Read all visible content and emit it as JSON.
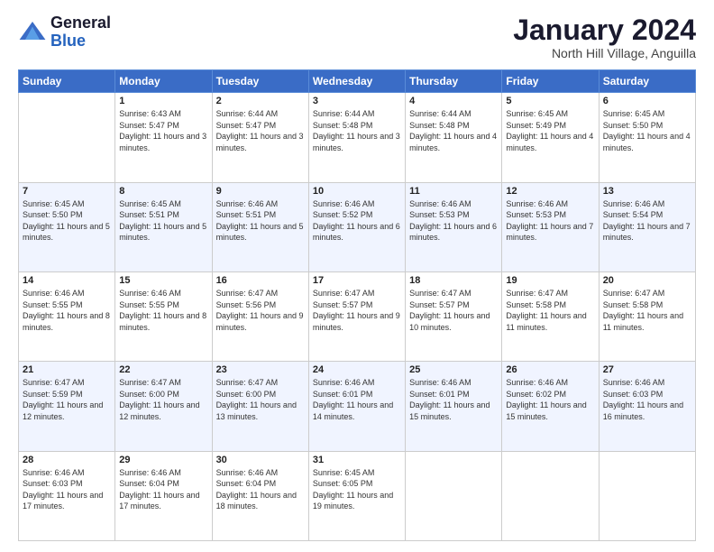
{
  "logo": {
    "general": "General",
    "blue": "Blue"
  },
  "title": "January 2024",
  "location": "North Hill Village, Anguilla",
  "days_header": [
    "Sunday",
    "Monday",
    "Tuesday",
    "Wednesday",
    "Thursday",
    "Friday",
    "Saturday"
  ],
  "weeks": [
    [
      {
        "num": "",
        "sunrise": "",
        "sunset": "",
        "daylight": ""
      },
      {
        "num": "1",
        "sunrise": "Sunrise: 6:43 AM",
        "sunset": "Sunset: 5:47 PM",
        "daylight": "Daylight: 11 hours and 3 minutes."
      },
      {
        "num": "2",
        "sunrise": "Sunrise: 6:44 AM",
        "sunset": "Sunset: 5:47 PM",
        "daylight": "Daylight: 11 hours and 3 minutes."
      },
      {
        "num": "3",
        "sunrise": "Sunrise: 6:44 AM",
        "sunset": "Sunset: 5:48 PM",
        "daylight": "Daylight: 11 hours and 3 minutes."
      },
      {
        "num": "4",
        "sunrise": "Sunrise: 6:44 AM",
        "sunset": "Sunset: 5:48 PM",
        "daylight": "Daylight: 11 hours and 4 minutes."
      },
      {
        "num": "5",
        "sunrise": "Sunrise: 6:45 AM",
        "sunset": "Sunset: 5:49 PM",
        "daylight": "Daylight: 11 hours and 4 minutes."
      },
      {
        "num": "6",
        "sunrise": "Sunrise: 6:45 AM",
        "sunset": "Sunset: 5:50 PM",
        "daylight": "Daylight: 11 hours and 4 minutes."
      }
    ],
    [
      {
        "num": "7",
        "sunrise": "Sunrise: 6:45 AM",
        "sunset": "Sunset: 5:50 PM",
        "daylight": "Daylight: 11 hours and 5 minutes."
      },
      {
        "num": "8",
        "sunrise": "Sunrise: 6:45 AM",
        "sunset": "Sunset: 5:51 PM",
        "daylight": "Daylight: 11 hours and 5 minutes."
      },
      {
        "num": "9",
        "sunrise": "Sunrise: 6:46 AM",
        "sunset": "Sunset: 5:51 PM",
        "daylight": "Daylight: 11 hours and 5 minutes."
      },
      {
        "num": "10",
        "sunrise": "Sunrise: 6:46 AM",
        "sunset": "Sunset: 5:52 PM",
        "daylight": "Daylight: 11 hours and 6 minutes."
      },
      {
        "num": "11",
        "sunrise": "Sunrise: 6:46 AM",
        "sunset": "Sunset: 5:53 PM",
        "daylight": "Daylight: 11 hours and 6 minutes."
      },
      {
        "num": "12",
        "sunrise": "Sunrise: 6:46 AM",
        "sunset": "Sunset: 5:53 PM",
        "daylight": "Daylight: 11 hours and 7 minutes."
      },
      {
        "num": "13",
        "sunrise": "Sunrise: 6:46 AM",
        "sunset": "Sunset: 5:54 PM",
        "daylight": "Daylight: 11 hours and 7 minutes."
      }
    ],
    [
      {
        "num": "14",
        "sunrise": "Sunrise: 6:46 AM",
        "sunset": "Sunset: 5:55 PM",
        "daylight": "Daylight: 11 hours and 8 minutes."
      },
      {
        "num": "15",
        "sunrise": "Sunrise: 6:46 AM",
        "sunset": "Sunset: 5:55 PM",
        "daylight": "Daylight: 11 hours and 8 minutes."
      },
      {
        "num": "16",
        "sunrise": "Sunrise: 6:47 AM",
        "sunset": "Sunset: 5:56 PM",
        "daylight": "Daylight: 11 hours and 9 minutes."
      },
      {
        "num": "17",
        "sunrise": "Sunrise: 6:47 AM",
        "sunset": "Sunset: 5:57 PM",
        "daylight": "Daylight: 11 hours and 9 minutes."
      },
      {
        "num": "18",
        "sunrise": "Sunrise: 6:47 AM",
        "sunset": "Sunset: 5:57 PM",
        "daylight": "Daylight: 11 hours and 10 minutes."
      },
      {
        "num": "19",
        "sunrise": "Sunrise: 6:47 AM",
        "sunset": "Sunset: 5:58 PM",
        "daylight": "Daylight: 11 hours and 11 minutes."
      },
      {
        "num": "20",
        "sunrise": "Sunrise: 6:47 AM",
        "sunset": "Sunset: 5:58 PM",
        "daylight": "Daylight: 11 hours and 11 minutes."
      }
    ],
    [
      {
        "num": "21",
        "sunrise": "Sunrise: 6:47 AM",
        "sunset": "Sunset: 5:59 PM",
        "daylight": "Daylight: 11 hours and 12 minutes."
      },
      {
        "num": "22",
        "sunrise": "Sunrise: 6:47 AM",
        "sunset": "Sunset: 6:00 PM",
        "daylight": "Daylight: 11 hours and 12 minutes."
      },
      {
        "num": "23",
        "sunrise": "Sunrise: 6:47 AM",
        "sunset": "Sunset: 6:00 PM",
        "daylight": "Daylight: 11 hours and 13 minutes."
      },
      {
        "num": "24",
        "sunrise": "Sunrise: 6:46 AM",
        "sunset": "Sunset: 6:01 PM",
        "daylight": "Daylight: 11 hours and 14 minutes."
      },
      {
        "num": "25",
        "sunrise": "Sunrise: 6:46 AM",
        "sunset": "Sunset: 6:01 PM",
        "daylight": "Daylight: 11 hours and 15 minutes."
      },
      {
        "num": "26",
        "sunrise": "Sunrise: 6:46 AM",
        "sunset": "Sunset: 6:02 PM",
        "daylight": "Daylight: 11 hours and 15 minutes."
      },
      {
        "num": "27",
        "sunrise": "Sunrise: 6:46 AM",
        "sunset": "Sunset: 6:03 PM",
        "daylight": "Daylight: 11 hours and 16 minutes."
      }
    ],
    [
      {
        "num": "28",
        "sunrise": "Sunrise: 6:46 AM",
        "sunset": "Sunset: 6:03 PM",
        "daylight": "Daylight: 11 hours and 17 minutes."
      },
      {
        "num": "29",
        "sunrise": "Sunrise: 6:46 AM",
        "sunset": "Sunset: 6:04 PM",
        "daylight": "Daylight: 11 hours and 17 minutes."
      },
      {
        "num": "30",
        "sunrise": "Sunrise: 6:46 AM",
        "sunset": "Sunset: 6:04 PM",
        "daylight": "Daylight: 11 hours and 18 minutes."
      },
      {
        "num": "31",
        "sunrise": "Sunrise: 6:45 AM",
        "sunset": "Sunset: 6:05 PM",
        "daylight": "Daylight: 11 hours and 19 minutes."
      },
      {
        "num": "",
        "sunrise": "",
        "sunset": "",
        "daylight": ""
      },
      {
        "num": "",
        "sunrise": "",
        "sunset": "",
        "daylight": ""
      },
      {
        "num": "",
        "sunrise": "",
        "sunset": "",
        "daylight": ""
      }
    ]
  ]
}
